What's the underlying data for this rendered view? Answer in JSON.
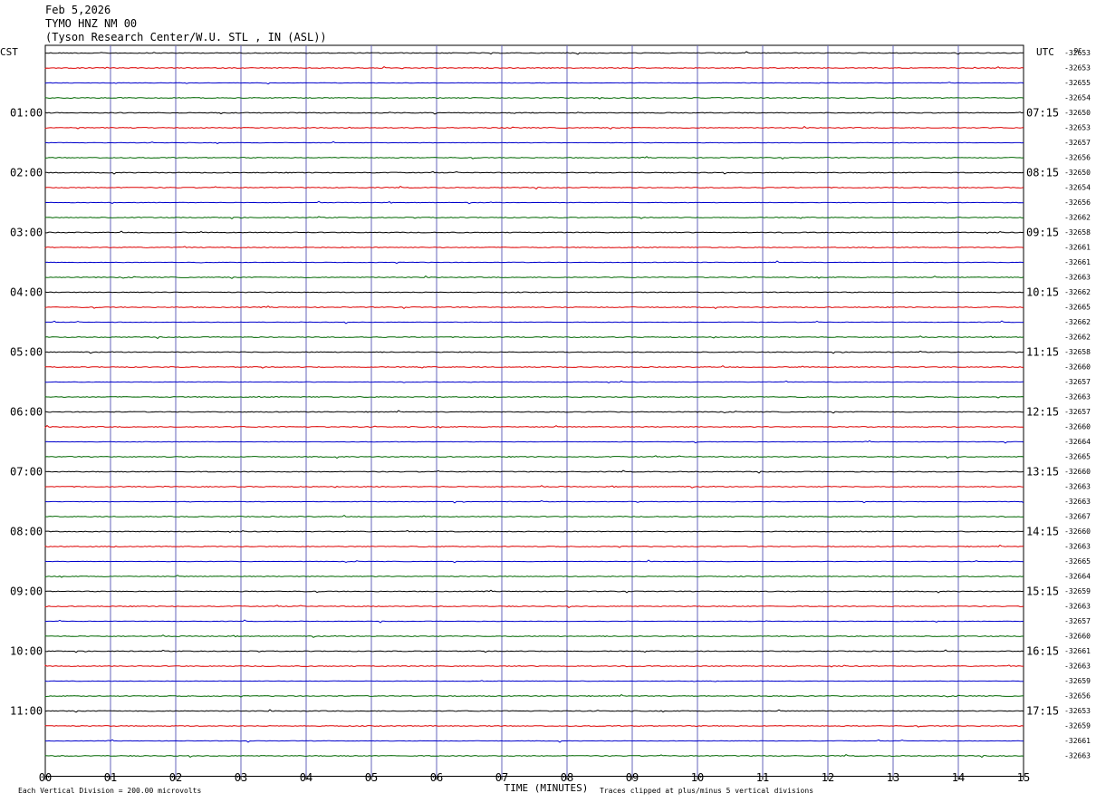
{
  "header": {
    "date": "Feb 5,2026",
    "station": "TYMO HNZ NM 00",
    "location": "(Tyson Research Center/W.U. STL , IN (ASL))"
  },
  "colors": {
    "black": "#000000",
    "red": "#dd0000",
    "blue": "#0000cc",
    "green": "#006600",
    "grid": "#6666bb"
  },
  "chart_data": {
    "type": "line",
    "title": "TYMO HNZ NM 00",
    "xlabel": "TIME (MINUTES)",
    "ylabel": "",
    "xlim": [
      0,
      15
    ],
    "x_ticks": [
      "00",
      "01",
      "02",
      "03",
      "04",
      "05",
      "06",
      "07",
      "08",
      "09",
      "10",
      "11",
      "12",
      "13",
      "14",
      "15"
    ],
    "left_axis_label": "CST",
    "right_axis_label": "UTC",
    "dc_label": "DC",
    "cst_labels": [
      "01:00",
      "02:00",
      "03:00",
      "04:00",
      "05:00",
      "06:00",
      "07:00",
      "08:00",
      "09:00",
      "10:00",
      "11:00"
    ],
    "utc_labels": [
      "07:15",
      "08:15",
      "09:15",
      "10:15",
      "11:15",
      "12:15",
      "13:15",
      "14:15",
      "15:15",
      "16:15",
      "17:15"
    ],
    "trace_color_cycle": [
      "black",
      "red",
      "blue",
      "green"
    ],
    "dc_offsets": [
      "-32653",
      "-32653",
      "-32655",
      "-32654",
      "-32650",
      "-32653",
      "-32657",
      "-32656",
      "-32650",
      "-32654",
      "-32656",
      "-32662",
      "-32658",
      "-32661",
      "-32661",
      "-32663",
      "-32662",
      "-32665",
      "-32662",
      "-32662",
      "-32658",
      "-32660",
      "-32657",
      "-32663",
      "-32657",
      "-32660",
      "-32664",
      "-32665",
      "-32660",
      "-32663",
      "-32663",
      "-32667",
      "-32660",
      "-32663",
      "-32665",
      "-32664",
      "-32659",
      "-32663",
      "-32657",
      "-32660",
      "-32661",
      "-32663",
      "-32659",
      "-32656",
      "-32653",
      "-32659",
      "-32661",
      "-32663"
    ],
    "footer_scale": "Each Vertical Division =  200.00 microvolts",
    "footer_clip": "Traces clipped at plus/minus 5 vertical divisions"
  }
}
